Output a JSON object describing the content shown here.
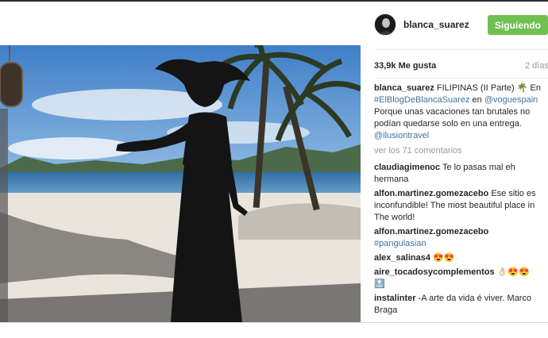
{
  "post": {
    "username": "blanca_suarez",
    "follow_label": "Siguiendo",
    "likes": "33,9k Me gusta",
    "time_ago": "2 días",
    "caption": {
      "user": "blanca_suarez",
      "text1": "FILIPINAS (II Parte)",
      "emoji": "🌴",
      "text2": "En",
      "hashtag": "#ElBlogDeBlancaSuarez",
      "text3": "en",
      "mention1": "@voguespain",
      "text4": "Porque unas vacaciones tan brutales no podían quedarse solo en una entrega.",
      "mention2": "@ilusiontravel"
    },
    "view_comments": "ver los 71 comentarios",
    "comments": [
      {
        "user": "claudiagimenoc",
        "text": "Te lo pasas mal eh hermana"
      },
      {
        "user": "alfon.martinez.gomezacebo",
        "text": "Ese sitio es inconfundible! The most beautiful place in The world!"
      },
      {
        "user": "alfon.martinez.gomezacebo",
        "tag": "#pangulasian"
      },
      {
        "user": "alex_salinas4",
        "text": "😍😍"
      },
      {
        "user": "aire_tocadosycomplementos",
        "text": "👌🏻😍😍 🔝"
      },
      {
        "user": "instalinter",
        "text": "-A arte da vida é viver. Marco Braga"
      }
    ]
  },
  "icons": {
    "avatar": "profile-avatar",
    "palm": "palm-tree-emoji"
  }
}
